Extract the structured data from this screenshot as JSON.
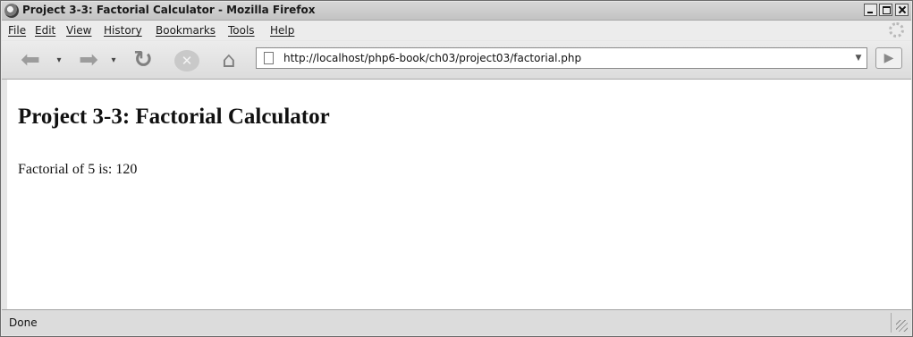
{
  "window": {
    "title": "Project 3-3: Factorial Calculator - Mozilla Firefox"
  },
  "menu": {
    "items": [
      {
        "label": "File"
      },
      {
        "label": "Edit"
      },
      {
        "label": "View"
      },
      {
        "label": "History"
      },
      {
        "label": "Bookmarks"
      },
      {
        "label": "Tools"
      },
      {
        "label": "Help"
      }
    ]
  },
  "toolbar": {
    "url": "http://localhost/php6-book/ch03/project03/factorial.php",
    "icons": {
      "back": "back-arrow-icon",
      "forward": "forward-arrow-icon",
      "reload": "reload-icon",
      "stop": "stop-icon",
      "home": "home-icon",
      "go": "go-arrow-icon"
    }
  },
  "page": {
    "heading": "Project 3-3: Factorial Calculator",
    "result": "Factorial of 5 is: 120"
  },
  "status": {
    "text": "Done"
  }
}
